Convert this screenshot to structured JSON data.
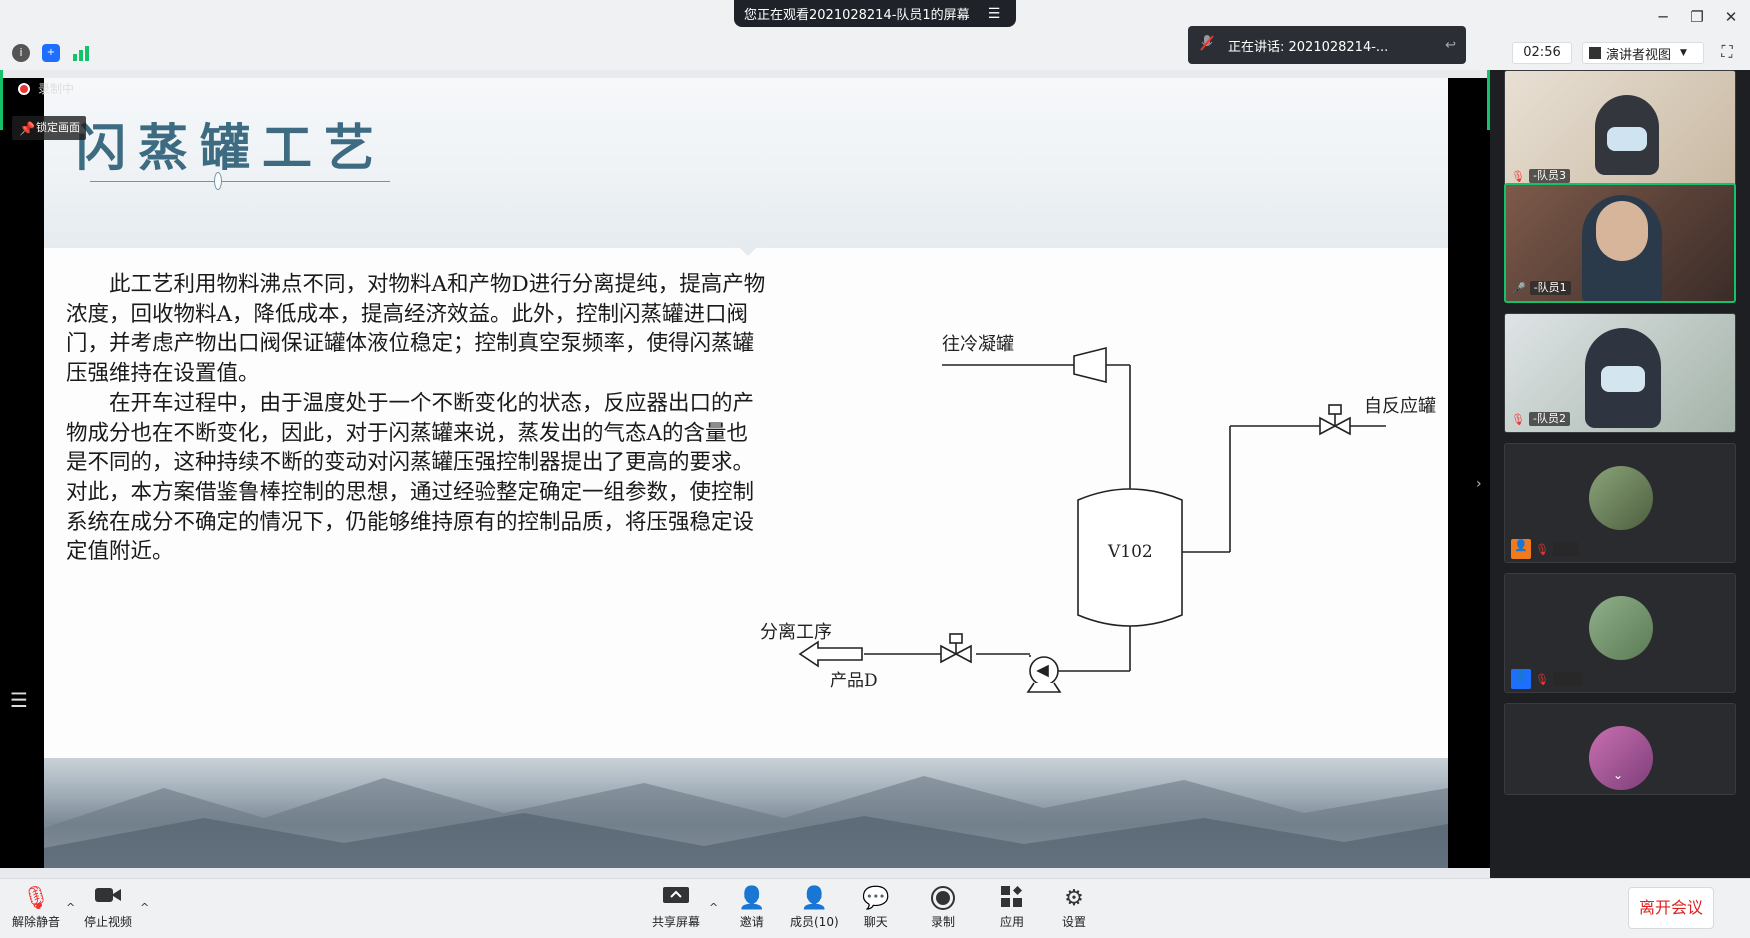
{
  "window": {
    "share_banner": "您正在观看2021028214-队员1的屏幕",
    "minimize": "─",
    "restore": "❐",
    "close": "✕"
  },
  "status": {
    "speaking": "正在讲话: 2021028214-...",
    "timer": "02:56",
    "view_mode": "演讲者视图"
  },
  "screen": {
    "recording": "录制中",
    "lock_screen": "锁定画面"
  },
  "slide": {
    "title": "闪蒸罐工艺",
    "paragraph1": "此工艺利用物料沸点不同，对物料A和产物D进行分离提纯，提高产物浓度，回收物料A，降低成本，提高经济效益。此外，控制闪蒸罐进口阀门，并考虑产物出口阀保证罐体液位稳定；控制真空泵频率，使得闪蒸罐压强维持在设置值。",
    "paragraph2": "在开车过程中，由于温度处于一个不断变化的状态，反应器出口的产物成分也在不断变化，因此，对于闪蒸罐来说，蒸发出的气态A的含量也是不同的，这种持续不断的变动对闪蒸罐压强控制器提出了更高的要求。对此，本方案借鉴鲁棒控制的思想，通过经验整定确定一组参数，使控制系统在成分不确定的情况下，仍能够维持原有的控制品质，将压强稳定设定值附近。",
    "diagram": {
      "to_condenser": "往冷凝罐",
      "from_reactor": "自反应罐",
      "vessel": "V102",
      "separation": "分离工序",
      "product": "产品D"
    }
  },
  "participants": [
    {
      "name": "-队员3",
      "muted": true
    },
    {
      "name": "-队员1",
      "muted": false
    },
    {
      "name": "-队员2",
      "muted": true
    },
    {
      "name": "",
      "muted": true
    },
    {
      "name": "",
      "muted": true
    },
    {
      "name": "",
      "muted": true
    }
  ],
  "toolbar": {
    "unmute": "解除静音",
    "stop_video": "停止视频",
    "share_screen": "共享屏幕",
    "invite": "邀请",
    "members": "成员(10)",
    "chat": "聊天",
    "record": "录制",
    "apps": "应用",
    "settings": "设置",
    "leave": "离开会议"
  }
}
